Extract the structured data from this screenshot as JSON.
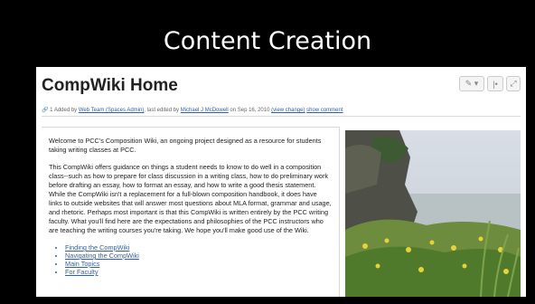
{
  "slide": {
    "title": "Content Creation"
  },
  "page": {
    "title": "CompWiki Home",
    "tools": {
      "edit_label": "✎ ▾",
      "info_label": "|•",
      "expand_label": "⤢"
    },
    "meta": {
      "prefix": "1  Added by",
      "author1": "Web Team (Spaces Admin)",
      "middle": ", last edited by",
      "author2": "Michael J McDowell",
      "date": "on Sep 16, 2010",
      "view_change": "(view change)",
      "show_comment": "show comment"
    }
  },
  "content": {
    "p1": "Welcome to PCC's Composition Wiki, an ongoing project designed as a resource for students taking writing classes at PCC.",
    "p2": "This CompWiki offers guidance on things a student needs to know to do well in a composition class--such as how to prepare for class discussion in a writing class, how to do preliminary work before drafting an essay, how to format an essay, and how to write a good thesis statement. While the CompWiki isn't a replacement for a full-blown composition handbook, it does have links to outside websites that will answer most questions about MLA format, grammar and usage, and rhetoric. Perhaps most important is that this CompWiki is written entirely by the PCC writing faculty. What you'll find here are the expectations and philosophies of the PCC instructors who are teaching the writing courses you're taking. We hope you'll make good use of the Wiki.",
    "links": [
      "Finding the CompWiki",
      "Navigating the CompWiki",
      "Main Topics",
      "For Faculty"
    ]
  }
}
